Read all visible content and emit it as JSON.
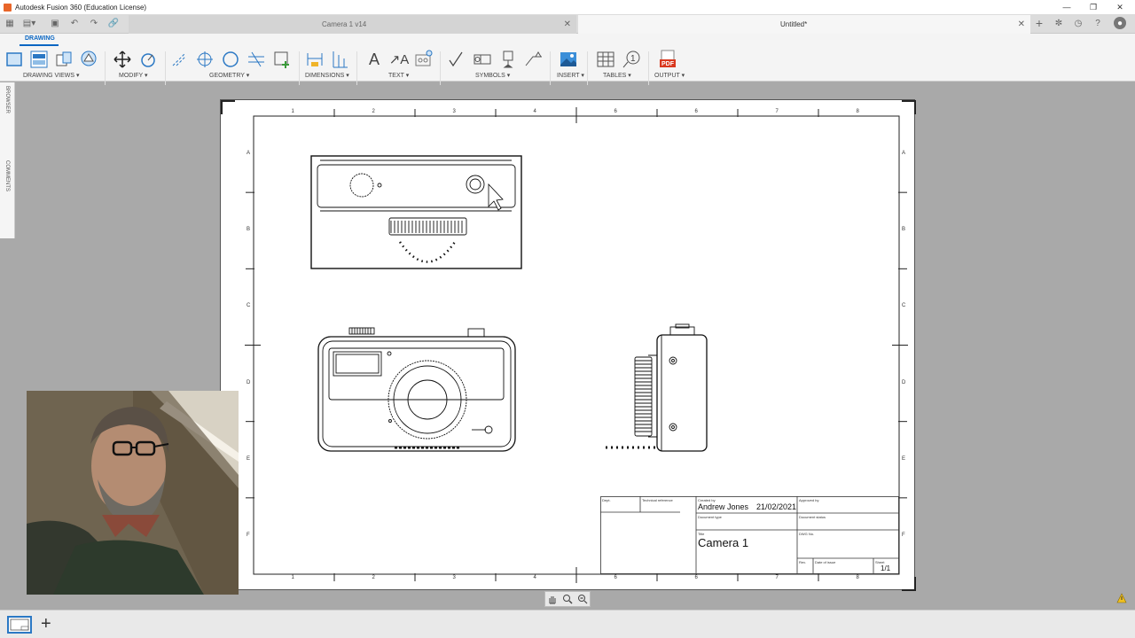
{
  "window": {
    "title": "Autodesk Fusion 360 (Education License)",
    "controls": [
      "minimize",
      "restore",
      "close"
    ]
  },
  "tabs": [
    {
      "label": "Camera 1 v14",
      "active": false
    },
    {
      "label": "Untitled*",
      "active": true
    }
  ],
  "ribbon": {
    "workspace": "DRAWING",
    "groups": [
      {
        "label": "DRAWING VIEWS ▾"
      },
      {
        "label": "MODIFY ▾"
      },
      {
        "label": "GEOMETRY ▾"
      },
      {
        "label": "DIMENSIONS ▾"
      },
      {
        "label": "TEXT ▾"
      },
      {
        "label": "SYMBOLS ▾"
      },
      {
        "label": "INSERT ▾"
      },
      {
        "label": "TABLES ▾"
      },
      {
        "label": "OUTPUT ▾"
      }
    ]
  },
  "side_panel": {
    "browser": "BROWSER",
    "comments": "COMMENTS"
  },
  "sheet": {
    "col_numbers": [
      "1",
      "2",
      "3",
      "4",
      "6",
      "6",
      "7",
      "8"
    ],
    "row_letters": [
      "A",
      "B",
      "C",
      "D",
      "E",
      "F"
    ]
  },
  "title_block": {
    "dept_label": "Dept.",
    "tech_ref_label": "Technical reference",
    "created_by_label": "Created by",
    "created_by": "Andrew Jones",
    "date": "21/02/2021",
    "approved_by_label": "Approved by",
    "doc_type_label": "Document type",
    "doc_status_label": "Document status",
    "title_label": "Title",
    "title": "Camera 1",
    "dwg_label": "DWG No.",
    "rev_label": "Rev.",
    "date_issue_label": "Date of issue",
    "sheet_label": "Sheet",
    "sheet": "1/1"
  },
  "colors": {
    "accent": "#0a66c2",
    "pdf": "#d9381e",
    "canvas": "#a9a9a9"
  }
}
